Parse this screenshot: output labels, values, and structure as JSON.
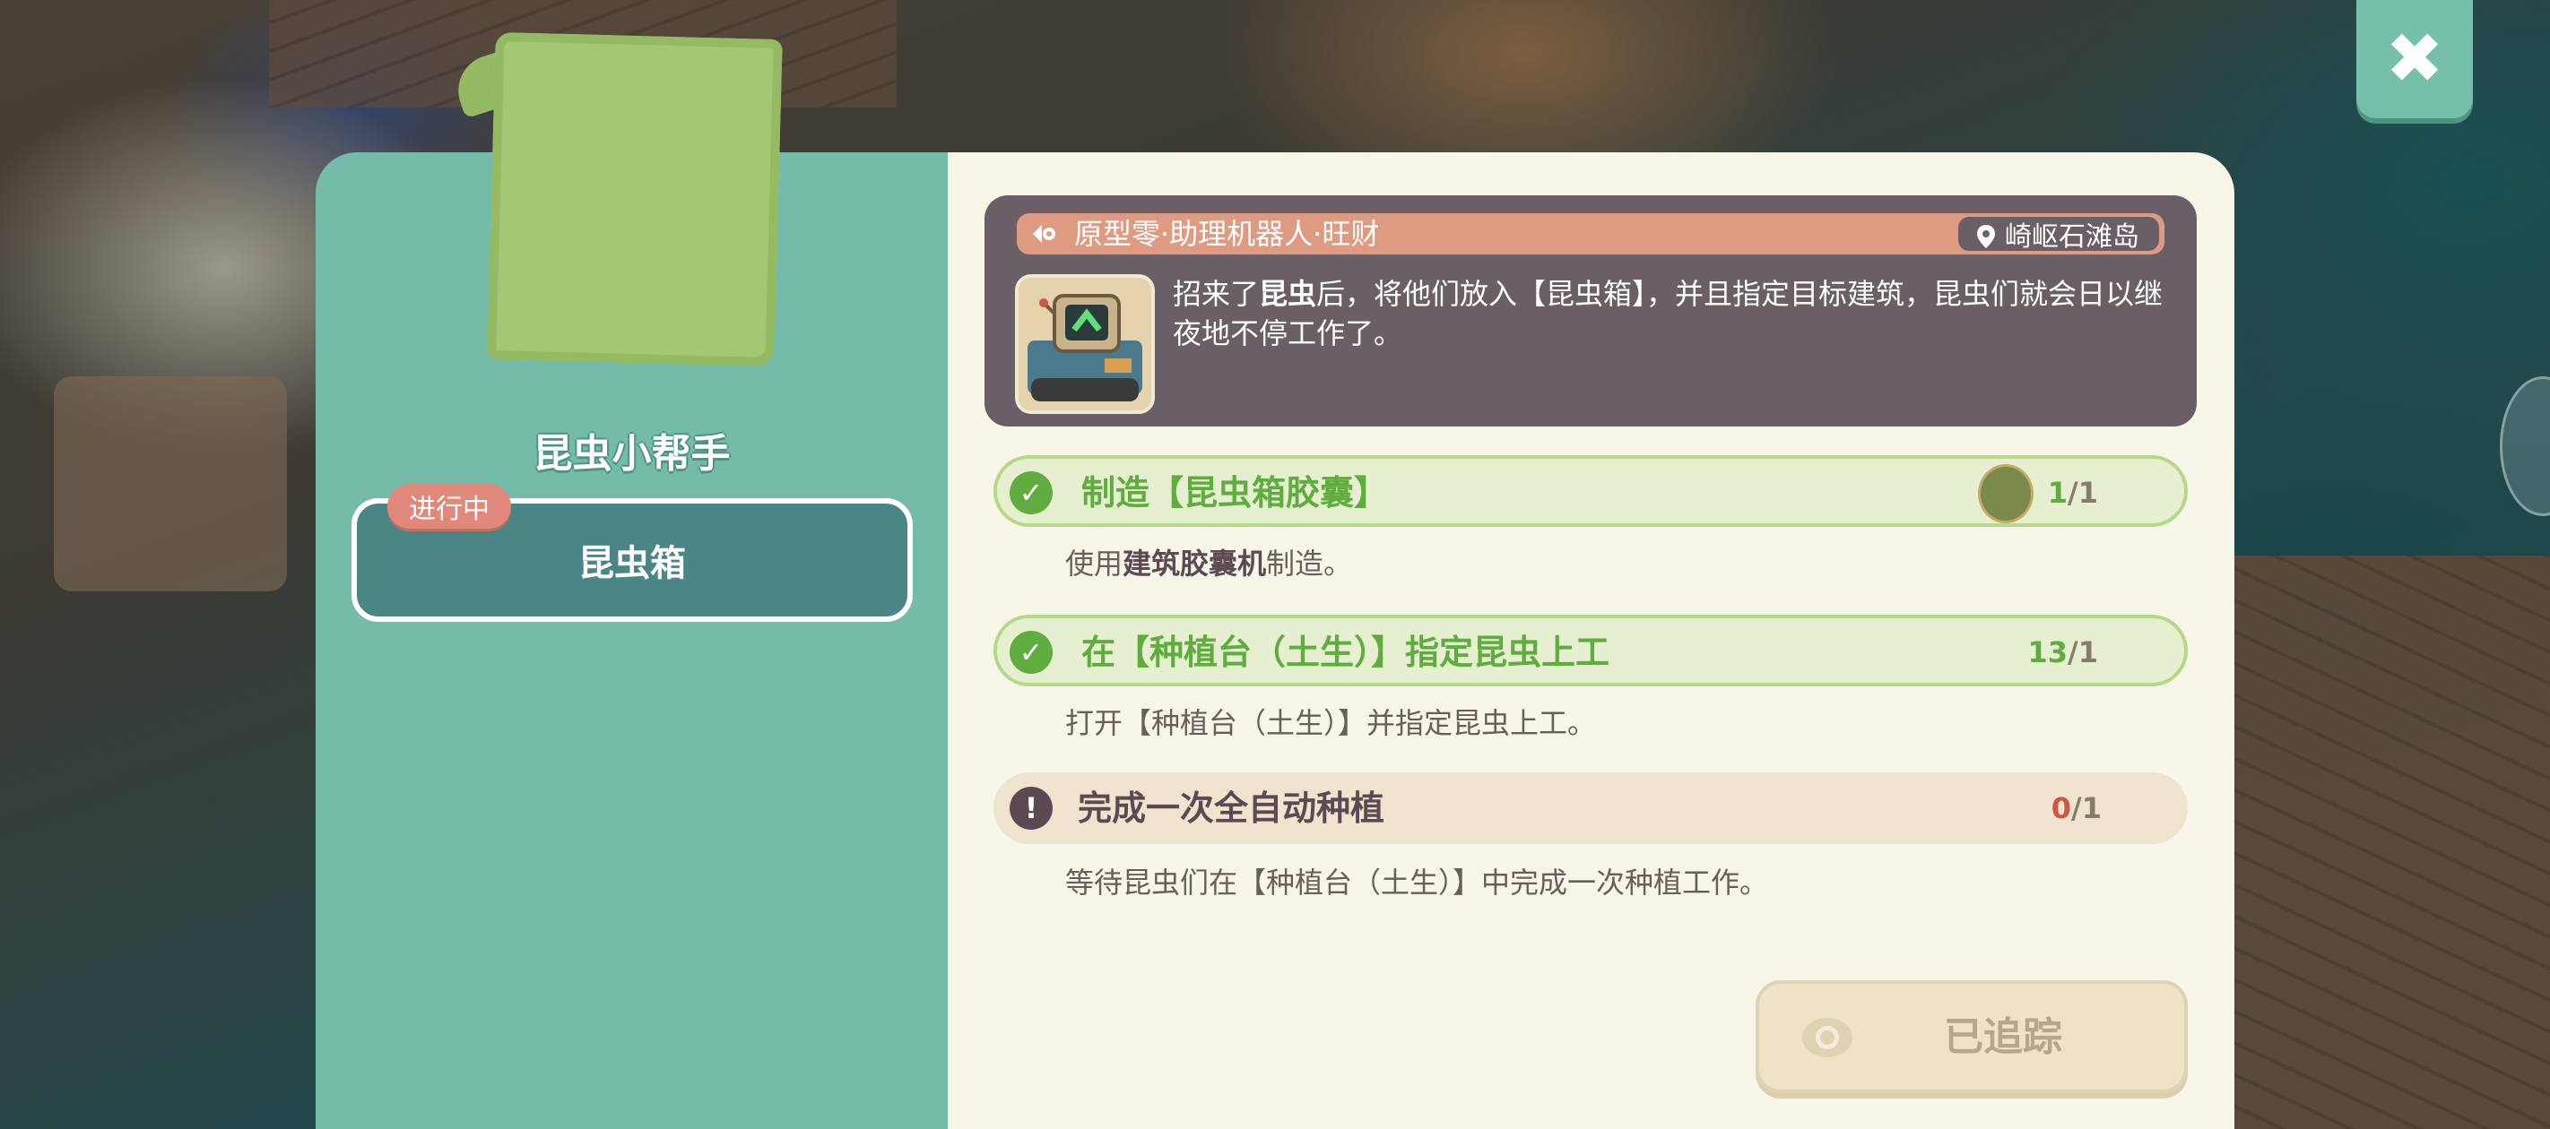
{
  "close_button": {
    "icon": "close-icon"
  },
  "quest": {
    "title": "昆虫小帮手",
    "status_badge": "进行中",
    "current_step": "昆虫箱"
  },
  "npc": {
    "name": "原型零·助理机器人·旺财",
    "location": "崎岖石滩岛",
    "description_parts": [
      "招来了",
      "昆虫",
      "后，将他们放入【昆虫箱】，并且指定目标建筑，昆虫们就会日以继夜地不停工作了。"
    ]
  },
  "objectives": [
    {
      "title": "制造【昆虫箱胶囊】",
      "status": "done",
      "progress_current": "1",
      "progress_total": "/1",
      "desc_parts": [
        "使用",
        "建筑胶囊机",
        "制造。"
      ],
      "has_item_icon": true
    },
    {
      "title": "在【种植台（土生）】指定昆虫上工",
      "status": "done",
      "progress_current": "13",
      "progress_total": "/1",
      "desc": "打开【种植台（土生）】并指定昆虫上工。"
    },
    {
      "title": "完成一次全自动种植",
      "status": "pending",
      "progress_current": "0",
      "progress_total": "/1",
      "desc": "等待昆虫们在【种植台（土生）】中完成一次种植工作。"
    }
  ],
  "track_button": {
    "label": "已追踪"
  },
  "colors": {
    "panel_left": "#74bba9",
    "panel_right": "#f8f6e8",
    "info_card": "#6a5e67",
    "done_green": "#5fad3f",
    "pending_red": "#d05544",
    "badge": "#e0897a"
  }
}
